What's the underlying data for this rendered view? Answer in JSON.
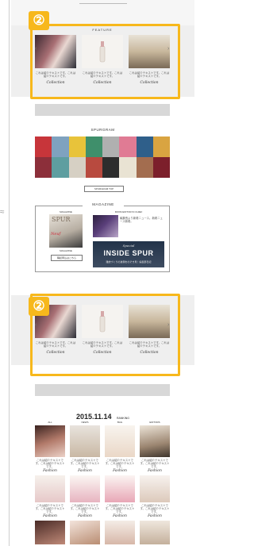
{
  "header": {
    "label": "FEATURE"
  },
  "badges": {
    "first": "②",
    "second": "②"
  },
  "carousel": {
    "desc_text": "これは紹介テキストです。これは紹介テキストです。",
    "link_label": "Collection",
    "prev_icon": "‹",
    "next_icon": "›"
  },
  "spurgram": {
    "title": "SPURGRAM",
    "button": "SPURGRAM TOP",
    "tile_colors": [
      "#c7353a",
      "#7fa2bf",
      "#e8c33a",
      "#3f8f6b",
      "#b0b0b0",
      "#e07b94",
      "#2f5f8a",
      "#d9a441",
      "#8c2f3a",
      "#5e9ea0",
      "#d6d0c4",
      "#b84a3f",
      "#2d2d2d",
      "#e9e3d3",
      "#a36d4f",
      "#7c1f2b"
    ]
  },
  "magazine": {
    "title": "MAGAZINE",
    "left_head": "MAGAZINE",
    "right_head": "FROM EDITOR IN CHIEF",
    "cover_title": "SPUR",
    "editor_text": "編集長より新着ニュース。新着ニュース新着。",
    "left_caption": "MAGAZINE",
    "left_button": "購読申込はこちら",
    "inside_small": "Special",
    "inside_title": "INSIDE SPUR",
    "inside_caption": "雑誌づくりの裏側をのぞき見！編集部日記"
  },
  "ranking": {
    "date": "2015.11.14",
    "label": "RANKING",
    "columns": [
      "ALL",
      "NEWS",
      "BAG",
      "EDITORS"
    ],
    "desc": "これは紹介テキストです。これは紹介テキストです。",
    "link": "Fashion"
  }
}
